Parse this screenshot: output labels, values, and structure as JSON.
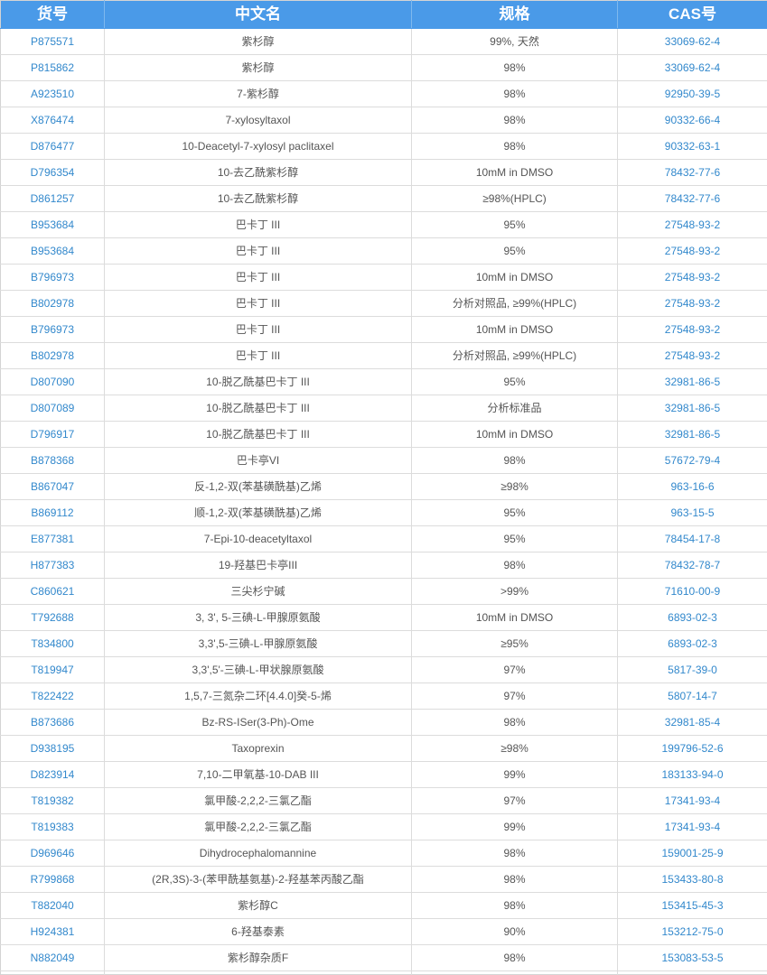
{
  "table": {
    "columns": [
      {
        "key": "code",
        "label": "货号"
      },
      {
        "key": "name",
        "label": "中文名"
      },
      {
        "key": "spec",
        "label": "规格"
      },
      {
        "key": "cas",
        "label": "CAS号"
      }
    ],
    "header_bg": "#4a9ae8",
    "header_text_color": "#ffffff",
    "link_color": "#3288cc",
    "body_text_color": "#555555",
    "border_color": "#dcdcdc",
    "rows": [
      {
        "code": "P875571",
        "name": "紫杉醇",
        "spec": "99%, 天然",
        "cas": "33069-62-4"
      },
      {
        "code": "P815862",
        "name": "紫杉醇",
        "spec": "98%",
        "cas": "33069-62-4"
      },
      {
        "code": "A923510",
        "name": "7-紫杉醇",
        "spec": "98%",
        "cas": "92950-39-5"
      },
      {
        "code": "X876474",
        "name": "7-xylosyltaxol",
        "spec": "98%",
        "cas": "90332-66-4"
      },
      {
        "code": "D876477",
        "name": "10-Deacetyl-7-xylosyl paclitaxel",
        "spec": "98%",
        "cas": "90332-63-1"
      },
      {
        "code": "D796354",
        "name": "10-去乙酰紫杉醇",
        "spec": "10mM in DMSO",
        "cas": "78432-77-6"
      },
      {
        "code": "D861257",
        "name": "10-去乙酰紫杉醇",
        "spec": "≥98%(HPLC)",
        "cas": "78432-77-6"
      },
      {
        "code": "B953684",
        "name": "巴卡丁 III",
        "spec": "95%",
        "cas": "27548-93-2"
      },
      {
        "code": "B953684",
        "name": "巴卡丁 III",
        "spec": "95%",
        "cas": "27548-93-2"
      },
      {
        "code": "B796973",
        "name": "巴卡丁 III",
        "spec": "10mM in DMSO",
        "cas": "27548-93-2"
      },
      {
        "code": "B802978",
        "name": "巴卡丁 III",
        "spec": "分析对照品, ≥99%(HPLC)",
        "cas": "27548-93-2"
      },
      {
        "code": "B796973",
        "name": "巴卡丁 III",
        "spec": "10mM in DMSO",
        "cas": "27548-93-2"
      },
      {
        "code": "B802978",
        "name": "巴卡丁 III",
        "spec": "分析对照品, ≥99%(HPLC)",
        "cas": "27548-93-2"
      },
      {
        "code": "D807090",
        "name": "10-脱乙酰基巴卡丁 III",
        "spec": "95%",
        "cas": "32981-86-5"
      },
      {
        "code": "D807089",
        "name": "10-脱乙酰基巴卡丁 III",
        "spec": "分析标准品",
        "cas": "32981-86-5"
      },
      {
        "code": "D796917",
        "name": "10-脱乙酰基巴卡丁 III",
        "spec": "10mM in DMSO",
        "cas": "32981-86-5"
      },
      {
        "code": "B878368",
        "name": "巴卡亭VI",
        "spec": "98%",
        "cas": "57672-79-4"
      },
      {
        "code": "B867047",
        "name": "反-1,2-双(苯基磺酰基)乙烯",
        "spec": "≥98%",
        "cas": "963-16-6"
      },
      {
        "code": "B869112",
        "name": "顺-1,2-双(苯基磺酰基)乙烯",
        "spec": "95%",
        "cas": "963-15-5"
      },
      {
        "code": "E877381",
        "name": "7-Epi-10-deacetyltaxol",
        "spec": "95%",
        "cas": "78454-17-8"
      },
      {
        "code": "H877383",
        "name": "19-羟基巴卡亭III",
        "spec": "98%",
        "cas": "78432-78-7"
      },
      {
        "code": "C860621",
        "name": "三尖杉宁碱",
        "spec": ">99%",
        "cas": "71610-00-9"
      },
      {
        "code": "T792688",
        "name": "3, 3', 5-三碘-L-甲腺原氨酸",
        "spec": "10mM in DMSO",
        "cas": "6893-02-3"
      },
      {
        "code": "T834800",
        "name": "3,3',5-三碘-L-甲腺原氨酸",
        "spec": "≥95%",
        "cas": "6893-02-3"
      },
      {
        "code": "T819947",
        "name": "3,3',5'-三碘-L-甲状腺原氨酸",
        "spec": "97%",
        "cas": "5817-39-0"
      },
      {
        "code": "T822422",
        "name": "1,5,7-三氮杂二环[4.4.0]癸-5-烯",
        "spec": "97%",
        "cas": "5807-14-7"
      },
      {
        "code": "B873686",
        "name": "Bz-RS-ISer(3-Ph)-Ome",
        "spec": "98%",
        "cas": "32981-85-4"
      },
      {
        "code": "D938195",
        "name": "Taxoprexin",
        "spec": "≥98%",
        "cas": "199796-52-6"
      },
      {
        "code": "D823914",
        "name": "7,10-二甲氧基-10-DAB III",
        "spec": "99%",
        "cas": "183133-94-0"
      },
      {
        "code": "T819382",
        "name": "氯甲酸-2,2,2-三氯乙酯",
        "spec": "97%",
        "cas": "17341-93-4"
      },
      {
        "code": "T819383",
        "name": "氯甲酸-2,2,2-三氯乙酯",
        "spec": "99%",
        "cas": "17341-93-4"
      },
      {
        "code": "D969646",
        "name": "Dihydrocephalomannine",
        "spec": "98%",
        "cas": "159001-25-9"
      },
      {
        "code": "R799868",
        "name": "(2R,3S)-3-(苯甲酰基氨基)-2-羟基苯丙酸乙酯",
        "spec": "98%",
        "cas": "153433-80-8"
      },
      {
        "code": "T882040",
        "name": "紫杉醇C",
        "spec": "98%",
        "cas": "153415-45-3"
      },
      {
        "code": "H924381",
        "name": "6-羟基泰素",
        "spec": "90%",
        "cas": "153212-75-0"
      },
      {
        "code": "N882049",
        "name": "紫杉醇杂质F",
        "spec": "98%",
        "cas": "153083-53-5"
      }
    ]
  }
}
